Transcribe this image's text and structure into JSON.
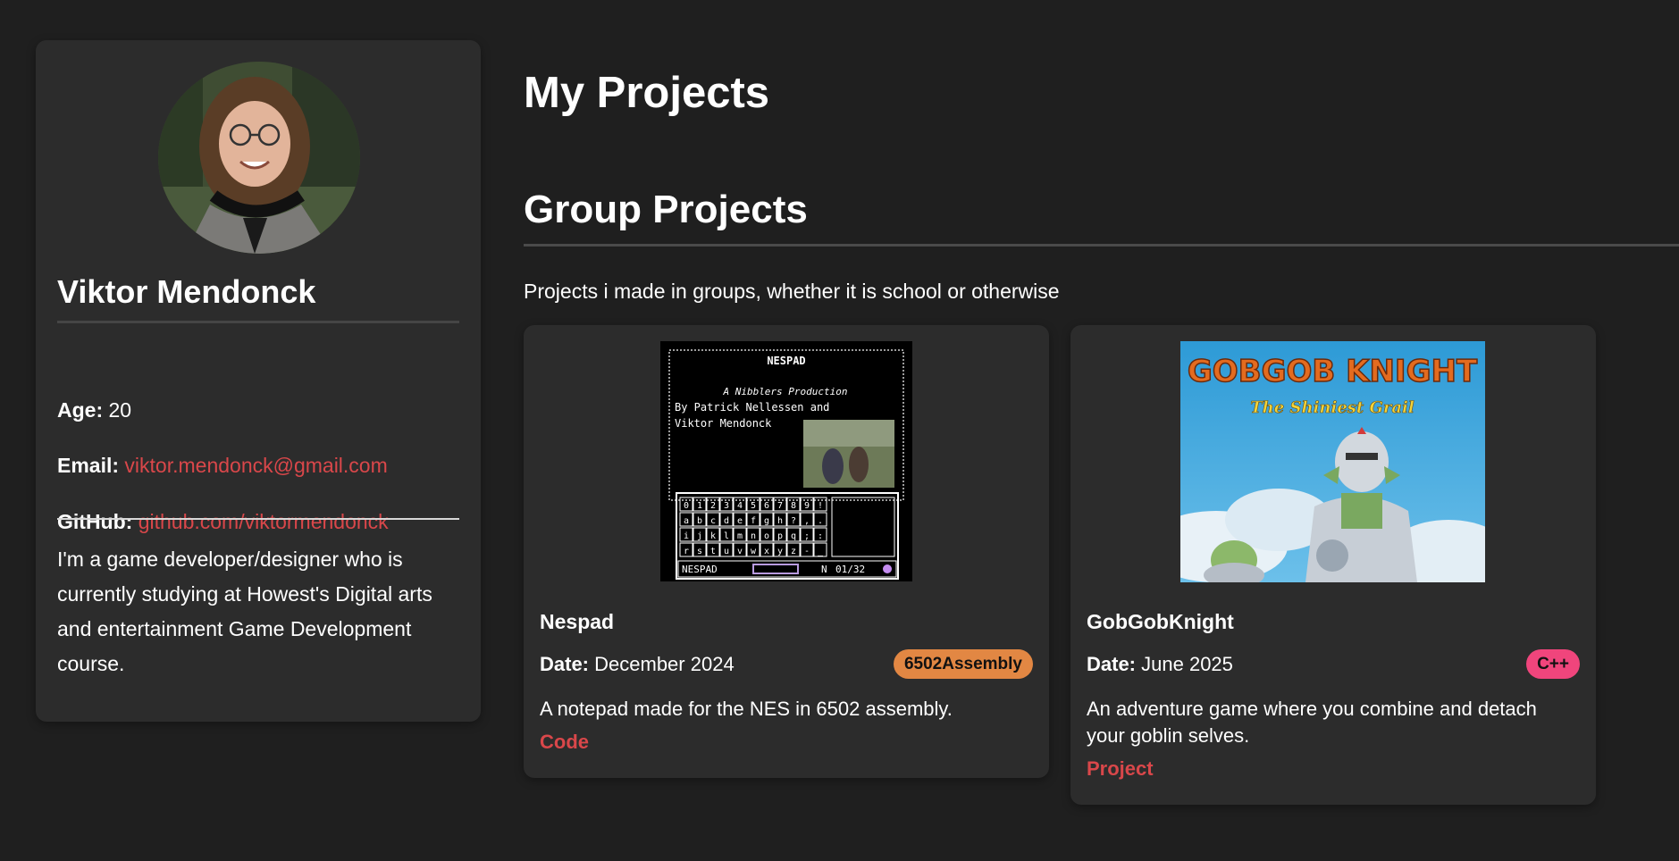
{
  "colors": {
    "background": "#1f1f1f",
    "card": "#2c2c2c",
    "link": "#d9474a",
    "text": "#ffffff"
  },
  "profile": {
    "avatar_icon": "person-portrait",
    "name": "Viktor Mendonck",
    "age_label": "Age:",
    "age_value": "20",
    "email_label": "Email:",
    "email_value": "viktor.mendonck@gmail.com",
    "github_label": "GitHub:",
    "github_value": "github.com/viktormendonck",
    "bio": "I'm a game developer/designer who is currently studying at Howest's Digital arts and entertainment Game Development course."
  },
  "main": {
    "title": "My Projects",
    "section": {
      "title": "Group Projects",
      "description": "Projects i made in groups, whether it is school or otherwise",
      "projects": [
        {
          "name": "Nespad",
          "date_label": "Date:",
          "date_value": "December 2024",
          "tag": "6502Assembly",
          "tag_color": "#e28743",
          "description": "A notepad made for the NES in 6502 assembly.",
          "link_label": "Code",
          "image": {
            "title": "NESPAD",
            "line1": "A Nibblers Production",
            "line2": "By Patrick Nellessen and",
            "line3": "Viktor Mendonck",
            "keys_row1": [
              "0",
              "1",
              "2",
              "3",
              "4",
              "5",
              "6",
              "7",
              "8",
              "9",
              "!"
            ],
            "keys_row2": [
              "a",
              "b",
              "c",
              "d",
              "e",
              "f",
              "g",
              "h",
              "?",
              ",",
              "."
            ],
            "keys_row3": [
              "i",
              "j",
              "k",
              "l",
              "m",
              "n",
              "o",
              "p",
              "q",
              ";",
              ":"
            ],
            "keys_row4": [
              "r",
              "s",
              "t",
              "u",
              "v",
              "w",
              "x",
              "y",
              "z",
              "-",
              "_"
            ],
            "status_name": "NESPAD",
            "status_mode": "N",
            "status_page": "01/32"
          }
        },
        {
          "name": "GobGobKnight",
          "date_label": "Date:",
          "date_value": "June 2025",
          "tag": "C++",
          "tag_color": "#f0457c",
          "description": "An adventure game where you combine and detach your goblin selves.",
          "link_label": "Project",
          "image": {
            "title": "GOBGOB KNIGHT",
            "subtitle": "The Shiniest Grail"
          }
        }
      ]
    }
  }
}
